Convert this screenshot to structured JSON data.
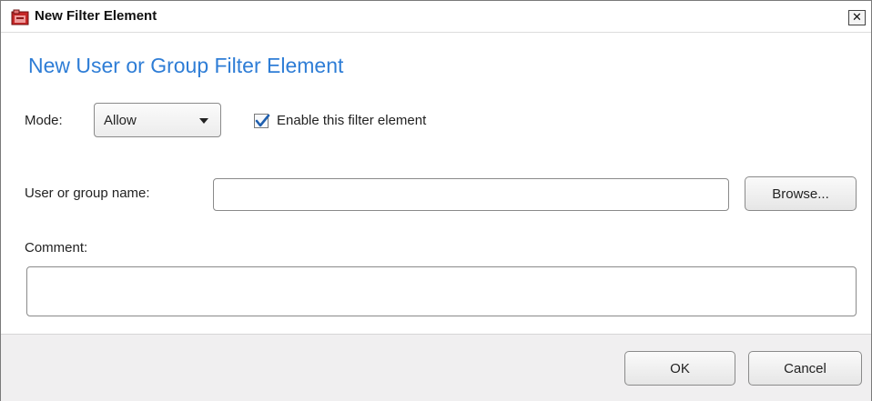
{
  "window": {
    "title": "New Filter Element",
    "close_label": "✕"
  },
  "heading": "New User or Group Filter Element",
  "mode": {
    "label": "Mode:",
    "selected": "Allow"
  },
  "enable_checkbox": {
    "label": "Enable this filter element",
    "checked": true
  },
  "user_group": {
    "label": "User or group name:",
    "value": "",
    "browse_label": "Browse..."
  },
  "comment": {
    "label": "Comment:",
    "value": ""
  },
  "footer": {
    "ok_label": "OK",
    "cancel_label": "Cancel"
  },
  "colors": {
    "heading": "#2e7dd6",
    "footer_bg": "#f0eff0",
    "checkmark": "#1f5fae"
  },
  "icons": {
    "window": "filter-window-icon",
    "dropdown": "chevron-down-icon",
    "check": "check-icon"
  }
}
